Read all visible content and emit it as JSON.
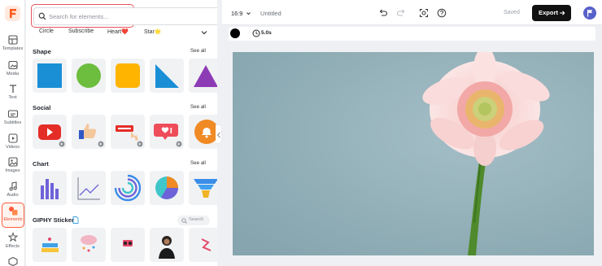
{
  "sidebar": {
    "items": [
      {
        "label": "Templates",
        "icon": "templates-icon"
      },
      {
        "label": "Media",
        "icon": "media-icon"
      },
      {
        "label": "Text",
        "icon": "text-icon"
      },
      {
        "label": "Subtitles",
        "icon": "subtitles-icon"
      },
      {
        "label": "Videos",
        "icon": "videos-icon"
      },
      {
        "label": "Images",
        "icon": "images-icon"
      },
      {
        "label": "Audio",
        "icon": "audio-icon"
      },
      {
        "label": "Elements",
        "icon": "elements-icon",
        "active": true
      },
      {
        "label": "Effects",
        "icon": "effects-icon"
      }
    ]
  },
  "panel": {
    "search_placeholder": "Search for elements...",
    "chips": [
      "Circle",
      "Subscribe",
      "Heart❤️",
      "Star🌟"
    ],
    "sections": {
      "shape": {
        "title": "Shape",
        "see_all": "See all"
      },
      "social": {
        "title": "Social",
        "see_all": "See all"
      },
      "chart": {
        "title": "Chart",
        "see_all": "See all"
      },
      "giphy": {
        "title": "GIPHY Sticker",
        "search_placeholder": "Search"
      }
    }
  },
  "topbar": {
    "aspect_ratio": "16:9",
    "title": "Untitled",
    "saved": "Saved",
    "export": "Export"
  },
  "toolbar": {
    "duration": "5.0s"
  },
  "colors": {
    "accent": "#ff5a3c",
    "shape_blue": "#1a8fd6",
    "shape_green": "#6dbd3f",
    "shape_yellow": "#ffb400",
    "shape_purple": "#8d3bb5",
    "canvas_bg": "#90aeb7"
  }
}
